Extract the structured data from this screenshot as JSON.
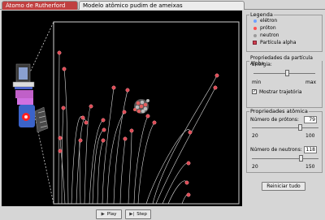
{
  "tabs": [
    {
      "label": "Átomo de Rutherford",
      "active": true
    },
    {
      "label": "Modelo atômico pudim de ameixas",
      "active": false
    }
  ],
  "controls": {
    "play_label": "Play",
    "step_label": "Step"
  },
  "legend": {
    "title": "Legenda",
    "items": [
      {
        "label": "elétron",
        "color": "#6fa0ff"
      },
      {
        "label": "próton",
        "color": "#ff5050"
      },
      {
        "label": "neutron",
        "color": "#9a9a9a"
      },
      {
        "label": "Partícula alpha",
        "color": "#d04050"
      }
    ]
  },
  "alpha": {
    "title": "Propriedades da partícula Alpha",
    "energy_label": "Energia:",
    "min_label": "min",
    "max_label": "max",
    "energy_value": 0.55,
    "trace_label": "Mostrar trajetória",
    "trace_checked": true
  },
  "atom": {
    "title": "Propriedades atômica",
    "protons_label": "Número de prótons:",
    "protons_value": "79",
    "protons_min": "20",
    "protons_max": "100",
    "protons_fraction": 0.74,
    "neutrons_label": "Número de neutrons:",
    "neutrons_value": "118",
    "neutrons_min": "20",
    "neutrons_max": "150",
    "neutrons_fraction": 0.75
  },
  "reset_label": "Reiniciar tudo"
}
